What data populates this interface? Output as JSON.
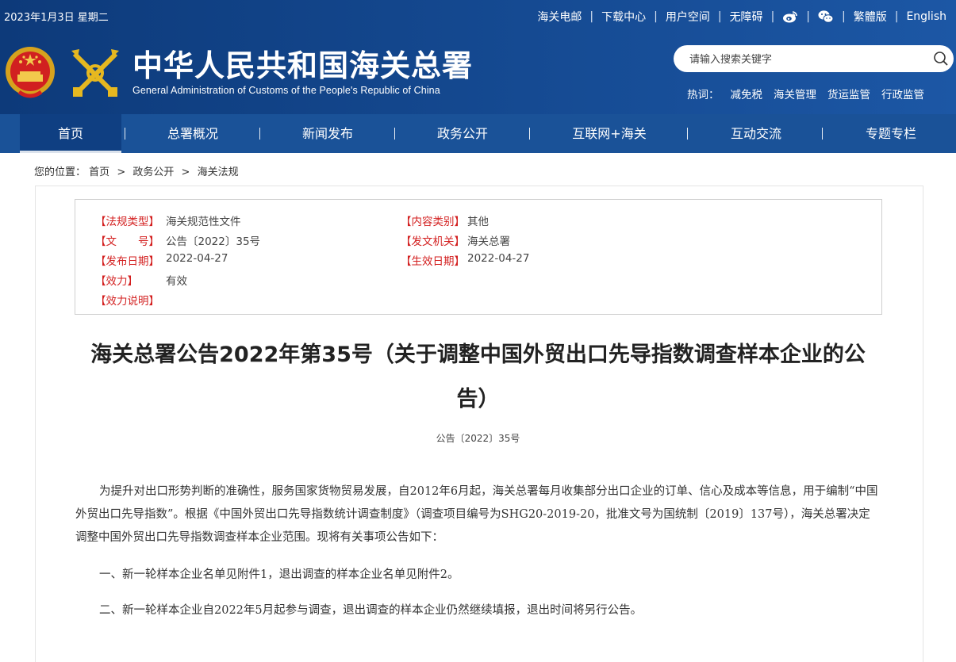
{
  "topbar": {
    "date": "2023年1月3日 星期二",
    "links": [
      "海关电邮",
      "下载中心",
      "用户空间",
      "无障碍"
    ],
    "social_icons": [
      "weibo-icon",
      "wechat-icon"
    ],
    "lang_links": [
      "繁體版",
      "English"
    ]
  },
  "branding": {
    "title": "中华人民共和国海关总署",
    "subtitle": "General Administration of Customs of the People's Republic of China"
  },
  "search": {
    "placeholder": "请输入搜索关键字",
    "hot_label": "热词：",
    "hot_words": [
      "减免税",
      "海关管理",
      "货运监管",
      "行政监管"
    ]
  },
  "nav": {
    "items": [
      "首页",
      "总署概况",
      "新闻发布",
      "政务公开",
      "互联网+海关",
      "互动交流",
      "专题专栏"
    ],
    "active": "首页"
  },
  "breadcrumb": {
    "prefix": "您的位置：",
    "items": [
      "首页",
      "政务公开",
      "海关法规"
    ],
    "separator": ">"
  },
  "meta": {
    "type_label": "【法规类型】",
    "type_value": "海关规范性文件",
    "category_label": "【内容类别】",
    "category_value": "其他",
    "docno_label": "【文　　号】",
    "docno_value": "公告〔2022〕35号",
    "issuer_label": "【发文机关】",
    "issuer_value": "海关总署",
    "publish_label": "【发布日期】",
    "publish_value": "2022-04-27",
    "effective_label": "【生效日期】",
    "effective_value": "2022-04-27",
    "validity_label": "【效力】",
    "validity_value": "有效",
    "validity_note_label": "【效力说明】",
    "validity_note_value": ""
  },
  "document": {
    "title": "海关总署公告2022年第35号（关于调整中国外贸出口先导指数调查样本企业的公告）",
    "number": "公告〔2022〕35号",
    "paragraphs": [
      "为提升对出口形势判断的准确性，服务国家货物贸易发展，自2012年6月起，海关总署每月收集部分出口企业的订单、信心及成本等信息，用于编制“中国外贸出口先导指数”。根据《中国外贸出口先导指数统计调查制度》（调查项目编号为SHG20-2019-20，批准文号为国统制〔2019〕137号），海关总署决定调整中国外贸出口先导指数调查样本企业范围。现将有关事项公告如下：",
      "一、新一轮样本企业名单见附件1，退出调查的样本企业名单见附件2。",
      "二、新一轮样本企业自2022年5月起参与调查，退出调查的样本企业仍然继续填报，退出时间将另行公告。"
    ]
  },
  "colors": {
    "header_bg": "#154a92",
    "nav_bg": "#1a5298",
    "nav_active": "#0f3f82",
    "meta_label": "#d31f1f"
  }
}
